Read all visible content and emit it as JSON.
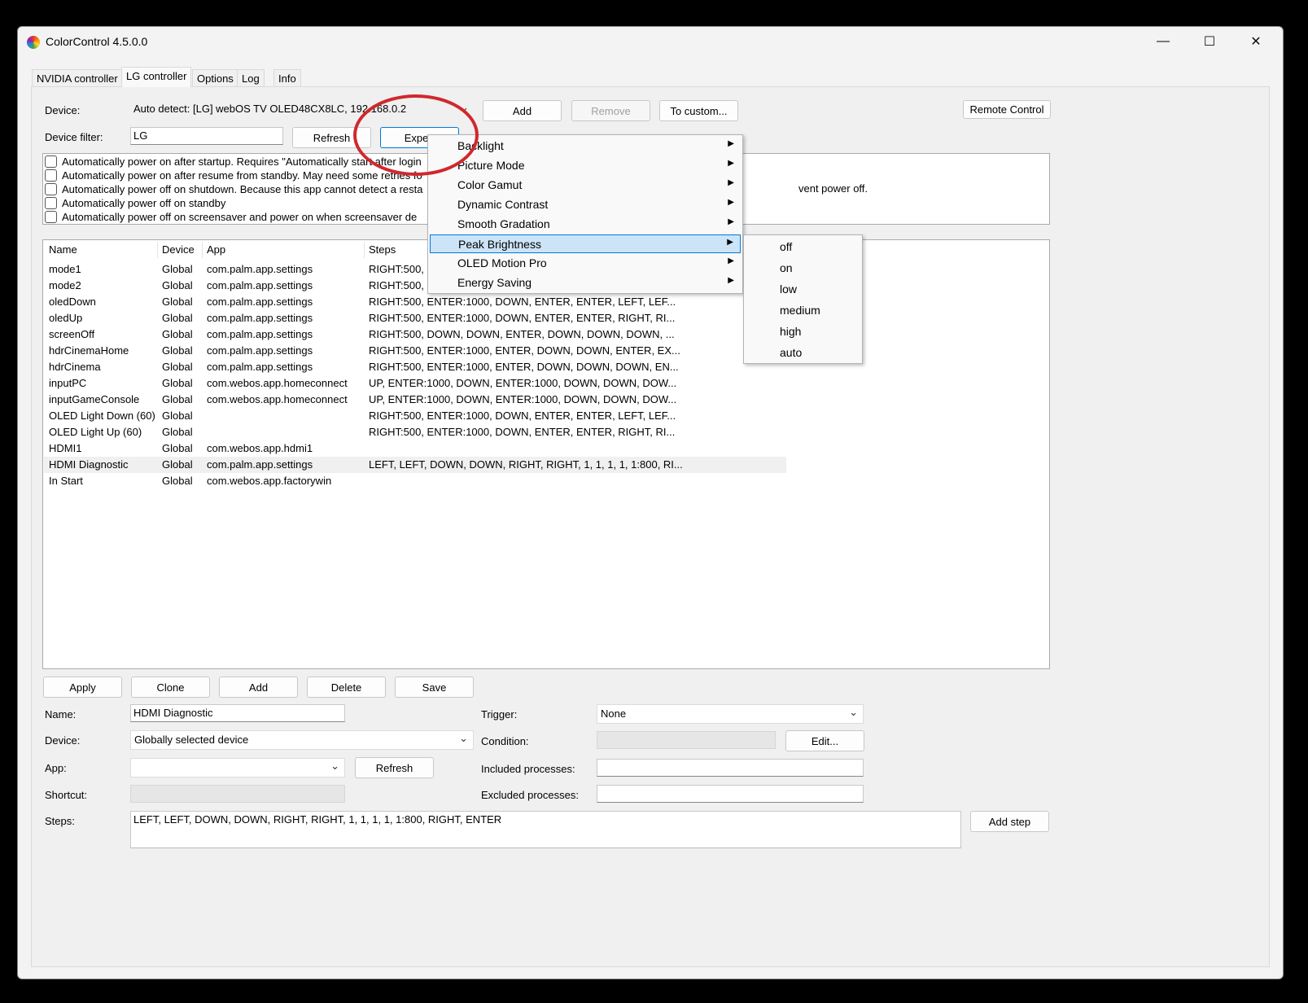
{
  "window": {
    "title": "ColorControl 4.5.0.0",
    "controls": [
      "—",
      "☐",
      "✕"
    ]
  },
  "tabs": [
    "NVIDIA controller",
    "LG controller",
    "Options",
    "Log",
    "Info"
  ],
  "device": {
    "label": "Device:",
    "value": "Auto detect: [LG] webOS TV OLED48CX8LC, 192.168.0.2",
    "add": "Add",
    "remove": "Remove",
    "to_custom": "To custom...",
    "remote_control": "Remote Control"
  },
  "filter": {
    "label": "Device filter:",
    "value": "LG",
    "refresh": "Refresh",
    "expert": "Expert"
  },
  "options": [
    "Automatically power on after startup. Requires \"Automatically start after login",
    "Automatically power on after resume from standby. May need some retries fo",
    "Automatically power off on shutdown. Because this app cannot detect a resta",
    "Automatically power off on standby",
    "Automatically power off on screensaver and power on when screensaver de"
  ],
  "options_tail": "vent power off.",
  "presets": {
    "columns": [
      "Name",
      "Device",
      "App",
      "Steps"
    ],
    "rows": [
      [
        "mode1",
        "Global",
        "com.palm.app.settings",
        "RIGHT:500, "
      ],
      [
        "mode2",
        "Global",
        "com.palm.app.settings",
        "RIGHT:500, "
      ],
      [
        "oledDown",
        "Global",
        "com.palm.app.settings",
        "RIGHT:500, ENTER:1000, DOWN, ENTER, ENTER, LEFT, LEF..."
      ],
      [
        "oledUp",
        "Global",
        "com.palm.app.settings",
        "RIGHT:500, ENTER:1000, DOWN, ENTER, ENTER, RIGHT, RI..."
      ],
      [
        "screenOff",
        "Global",
        "com.palm.app.settings",
        "RIGHT:500, DOWN, DOWN, ENTER, DOWN, DOWN, DOWN, ..."
      ],
      [
        "hdrCinemaHome",
        "Global",
        "com.palm.app.settings",
        "RIGHT:500, ENTER:1000, ENTER, DOWN, DOWN, ENTER, EX..."
      ],
      [
        "hdrCinema",
        "Global",
        "com.palm.app.settings",
        "RIGHT:500, ENTER:1000, ENTER, DOWN, DOWN, DOWN, EN..."
      ],
      [
        "inputPC",
        "Global",
        "com.webos.app.homeconnect",
        "UP, ENTER:1000, DOWN, ENTER:1000, DOWN, DOWN, DOW..."
      ],
      [
        "inputGameConsole",
        "Global",
        "com.webos.app.homeconnect",
        "UP, ENTER:1000, DOWN, ENTER:1000, DOWN, DOWN, DOW..."
      ],
      [
        "OLED Light Down (60)",
        "Global",
        "",
        "RIGHT:500, ENTER:1000, DOWN, ENTER, ENTER, LEFT, LEF..."
      ],
      [
        "OLED Light Up (60)",
        "Global",
        "",
        "RIGHT:500, ENTER:1000, DOWN, ENTER, ENTER, RIGHT, RI..."
      ],
      [
        "HDMI1",
        "Global",
        "com.webos.app.hdmi1",
        ""
      ],
      [
        "HDMI Diagnostic",
        "Global",
        "com.palm.app.settings",
        "LEFT, LEFT, DOWN, DOWN, RIGHT, RIGHT, 1, 1, 1, 1, 1:800, RI..."
      ],
      [
        "In Start",
        "Global",
        "com.webos.app.factorywin",
        ""
      ]
    ],
    "selected_row": "HDMI Diagnostic"
  },
  "actions": {
    "apply": "Apply",
    "clone": "Clone",
    "add": "Add",
    "delete": "Delete",
    "save": "Save"
  },
  "form": {
    "name_label": "Name:",
    "name_value": "HDMI Diagnostic",
    "device_label": "Device:",
    "device_value": "Globally selected device",
    "app_label": "App:",
    "app_value": "",
    "app_refresh": "Refresh",
    "shortcut_label": "Shortcut:",
    "shortcut_value": "",
    "steps_label": "Steps:",
    "steps_value": "LEFT, LEFT, DOWN, DOWN, RIGHT, RIGHT, 1, 1, 1, 1, 1:800, RIGHT, ENTER",
    "add_step": "Add step",
    "trigger_label": "Trigger:",
    "trigger_value": "None",
    "condition_label": "Condition:",
    "condition_value": "",
    "condition_edit": "Edit...",
    "included_label": "Included processes:",
    "included_value": "",
    "excluded_label": "Excluded processes:",
    "excluded_value": ""
  },
  "expert_menu": {
    "items": [
      "Backlight",
      "Picture Mode",
      "Color Gamut",
      "Dynamic Contrast",
      "Smooth Gradation",
      "Peak Brightness",
      "OLED Motion Pro",
      "Energy Saving"
    ],
    "highlighted": "Peak Brightness"
  },
  "peak_brightness_submenu": [
    "off",
    "on",
    "low",
    "medium",
    "high",
    "auto"
  ],
  "colors": {
    "menu_highlight": "#cce4f7",
    "menu_highlight_border": "#0078d7",
    "annotation": "#d0282e"
  }
}
